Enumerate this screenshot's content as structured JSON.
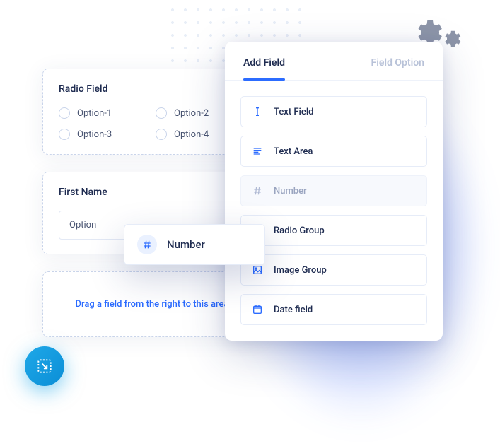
{
  "canvas": {
    "radio_card": {
      "title": "Radio Field",
      "options": [
        "Option-1",
        "Option-2",
        "Option-3",
        "Option-4"
      ]
    },
    "text_card": {
      "title": "First Name",
      "value": "Option"
    },
    "dropzone_text": "Drag a field from the right to this area"
  },
  "panel": {
    "tabs": {
      "add_field": "Add Field",
      "field_option": "Field Option"
    },
    "fields": [
      {
        "label": "Text Field",
        "icon": "text-cursor-icon"
      },
      {
        "label": "Text Area",
        "icon": "text-lines-icon"
      },
      {
        "label": "Number",
        "icon": "hash-icon",
        "muted": true
      },
      {
        "label": "Radio Group",
        "icon": "radio-icon"
      },
      {
        "label": "Image Group",
        "icon": "image-icon"
      },
      {
        "label": "Date field",
        "icon": "calendar-icon"
      }
    ]
  },
  "drag_ghost": {
    "label": "Number",
    "icon": "hash-icon"
  }
}
